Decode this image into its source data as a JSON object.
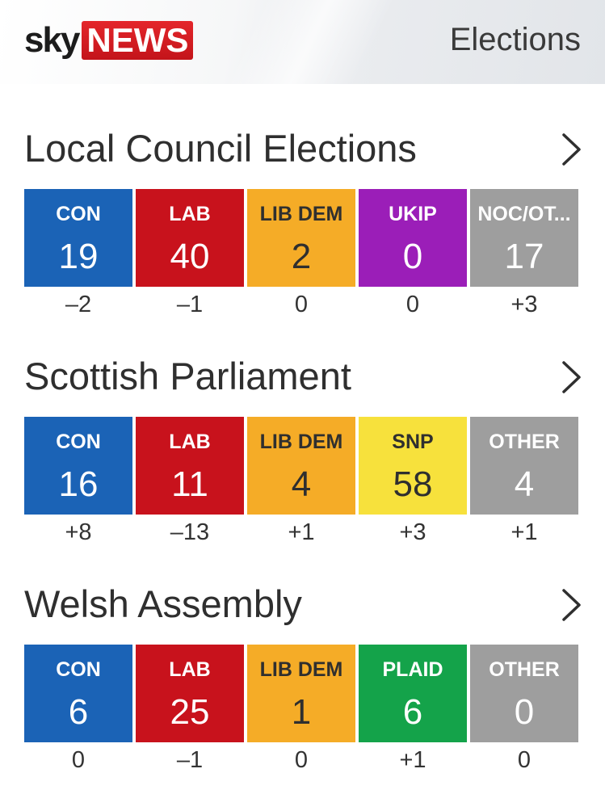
{
  "header": {
    "logo_left": "sky",
    "logo_right": "NEWS",
    "title": "Elections"
  },
  "colors": {
    "con": "#1b63b6",
    "lab": "#c8121c",
    "lib_dem": "#f5ac27",
    "ukip": "#9b1eb8",
    "snp": "#f7e13c",
    "plaid": "#14a34a",
    "other": "#9e9e9e"
  },
  "sections": [
    {
      "title": "Local Council Elections",
      "icon": "chevron-right-icon",
      "parties": [
        {
          "label": "CON",
          "seats": "19",
          "change": "–2",
          "color": "#1b63b6",
          "text": "light"
        },
        {
          "label": "LAB",
          "seats": "40",
          "change": "–1",
          "color": "#c8121c",
          "text": "light"
        },
        {
          "label": "LIB DEM",
          "seats": "2",
          "change": "0",
          "color": "#f5ac27",
          "text": "dark"
        },
        {
          "label": "UKIP",
          "seats": "0",
          "change": "0",
          "color": "#9b1eb8",
          "text": "light"
        },
        {
          "label": "NOC/OT...",
          "seats": "17",
          "change": "+3",
          "color": "#9e9e9e",
          "text": "light"
        }
      ]
    },
    {
      "title": "Scottish Parliament",
      "icon": "chevron-right-icon",
      "parties": [
        {
          "label": "CON",
          "seats": "16",
          "change": "+8",
          "color": "#1b63b6",
          "text": "light"
        },
        {
          "label": "LAB",
          "seats": "11",
          "change": "–13",
          "color": "#c8121c",
          "text": "light"
        },
        {
          "label": "LIB DEM",
          "seats": "4",
          "change": "+1",
          "color": "#f5ac27",
          "text": "dark"
        },
        {
          "label": "SNP",
          "seats": "58",
          "change": "+3",
          "color": "#f7e13c",
          "text": "dark"
        },
        {
          "label": "OTHER",
          "seats": "4",
          "change": "+1",
          "color": "#9e9e9e",
          "text": "light"
        }
      ]
    },
    {
      "title": "Welsh Assembly",
      "icon": "chevron-right-icon",
      "parties": [
        {
          "label": "CON",
          "seats": "6",
          "change": "0",
          "color": "#1b63b6",
          "text": "light"
        },
        {
          "label": "LAB",
          "seats": "25",
          "change": "–1",
          "color": "#c8121c",
          "text": "light"
        },
        {
          "label": "LIB DEM",
          "seats": "1",
          "change": "0",
          "color": "#f5ac27",
          "text": "dark"
        },
        {
          "label": "PLAID",
          "seats": "6",
          "change": "+1",
          "color": "#14a34a",
          "text": "light"
        },
        {
          "label": "OTHER",
          "seats": "0",
          "change": "0",
          "color": "#9e9e9e",
          "text": "light"
        }
      ]
    }
  ]
}
